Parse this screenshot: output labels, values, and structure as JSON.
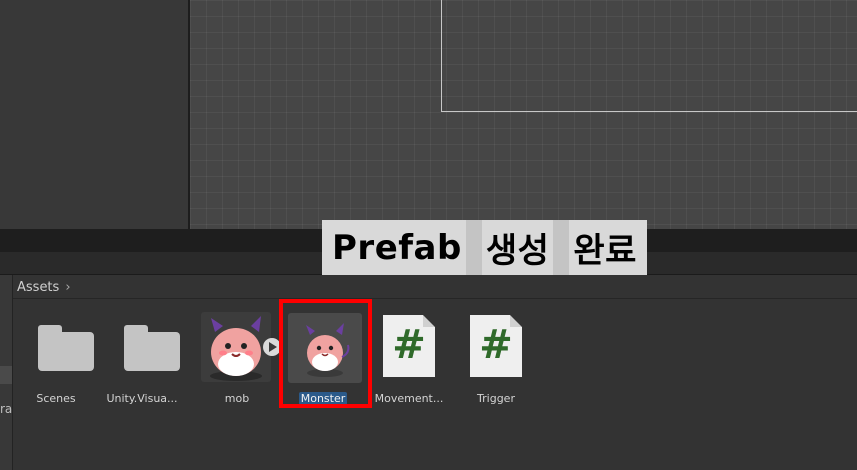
{
  "overlay": {
    "banner_word1": "Prefab",
    "banner_word2": "생성",
    "banner_word3": "완료"
  },
  "project": {
    "breadcrumb": "Assets",
    "left_panel_partial_text": "ra",
    "assets": [
      {
        "label": "Scenes",
        "type": "folder"
      },
      {
        "label": "Unity.Visua...",
        "type": "folder"
      },
      {
        "label": "mob",
        "type": "sprite-sheet"
      },
      {
        "label": "Monster",
        "type": "prefab",
        "selected": true
      },
      {
        "label": "Movement...",
        "type": "csharp-script"
      },
      {
        "label": "Trigger",
        "type": "csharp-script"
      }
    ]
  },
  "colors": {
    "highlight": "#ff0000",
    "selection": "#2b5a8a",
    "script_hash": "#2f6a2a"
  },
  "icons": {
    "script": "#"
  }
}
